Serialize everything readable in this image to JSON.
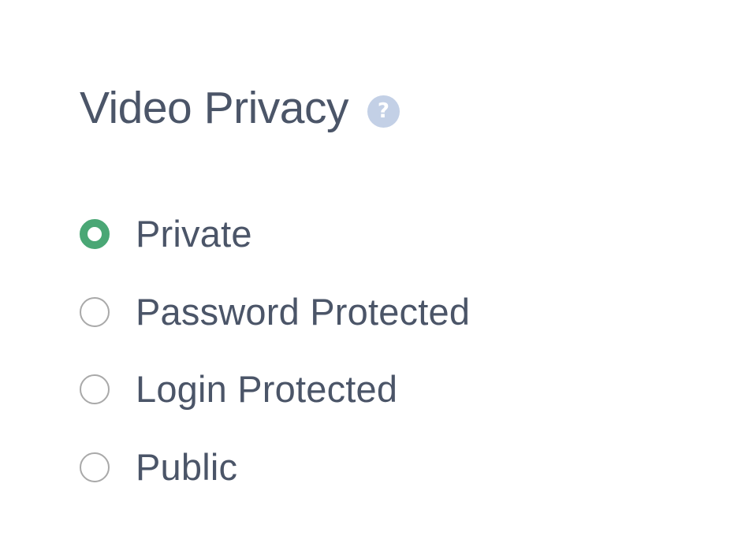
{
  "privacy": {
    "title": "Video Privacy",
    "help_icon": "question-mark-icon",
    "help_glyph": "?",
    "accent_color": "#4aa775",
    "options": [
      {
        "label": "Private",
        "selected": true
      },
      {
        "label": "Password Protected",
        "selected": false
      },
      {
        "label": "Login Protected",
        "selected": false
      },
      {
        "label": "Public",
        "selected": false
      }
    ]
  }
}
